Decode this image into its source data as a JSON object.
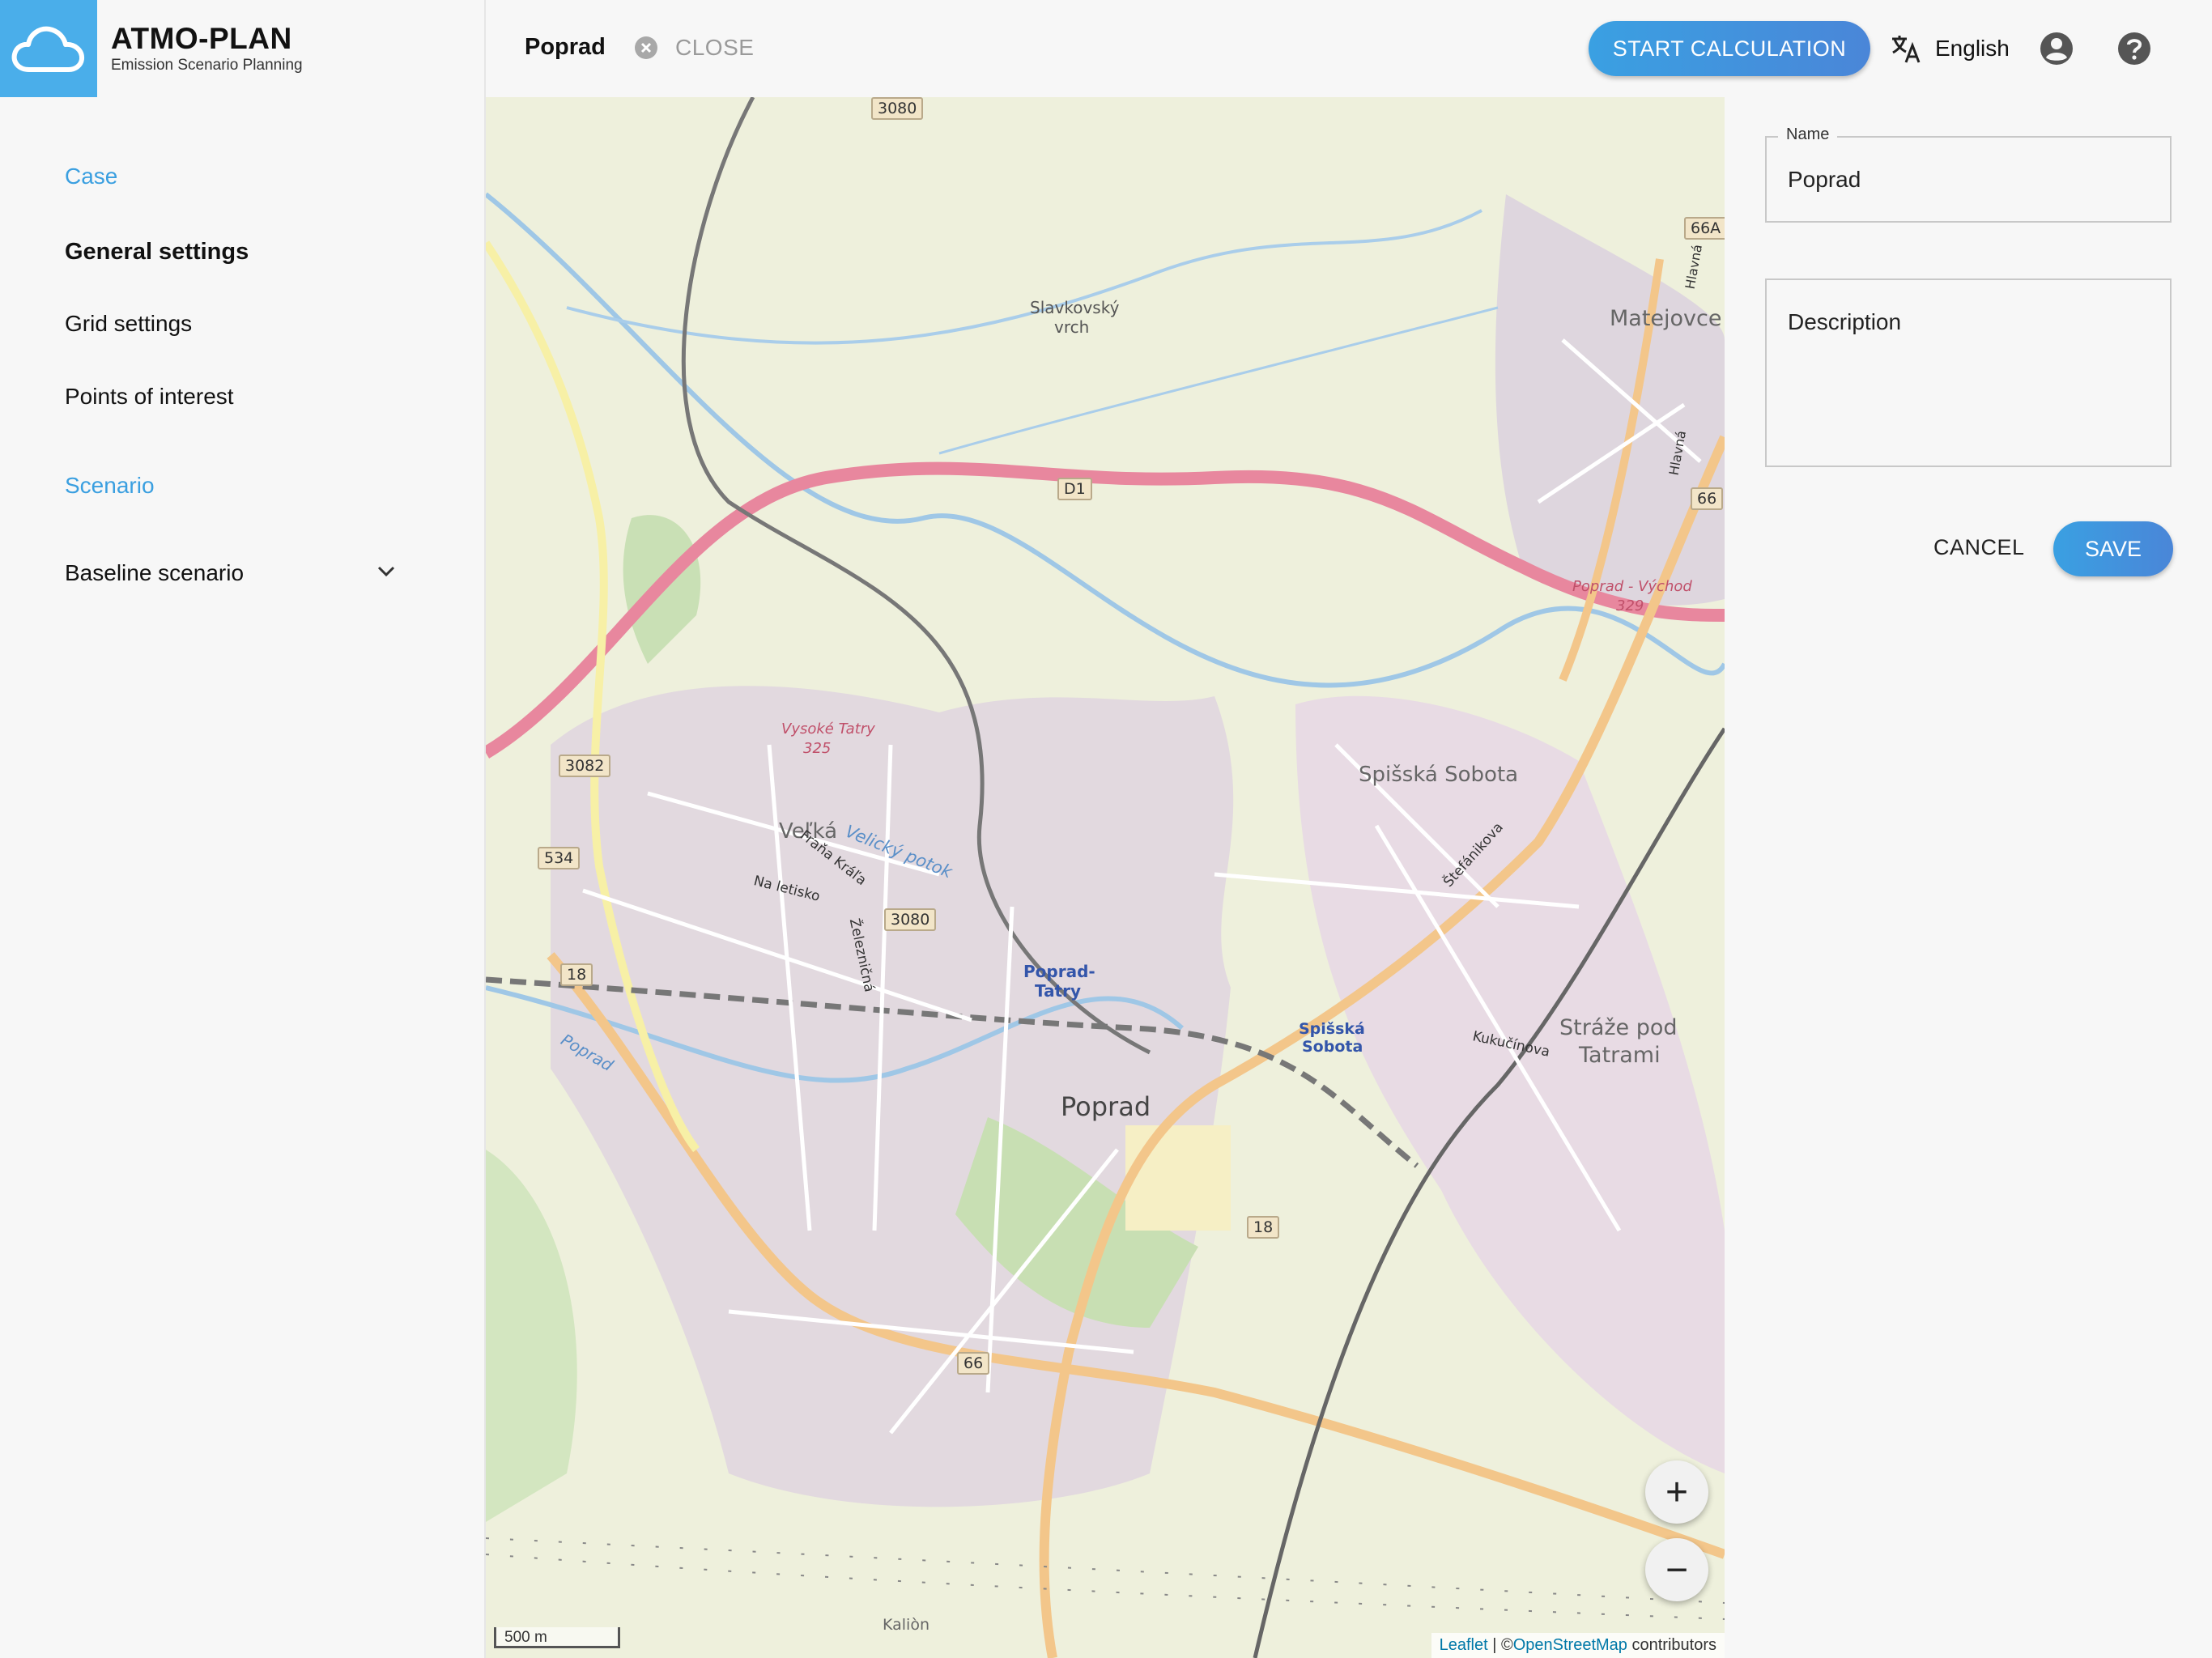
{
  "app": {
    "title": "ATMO-PLAN",
    "subtitle": "Emission Scenario Planning",
    "logo_icon": "cloud-icon"
  },
  "sidebar": {
    "case_label": "Case",
    "items": [
      {
        "label": "General settings",
        "active": true
      },
      {
        "label": "Grid settings",
        "active": false
      },
      {
        "label": "Points of interest",
        "active": false
      }
    ],
    "scenario_label": "Scenario",
    "scenario_select": "Baseline scenario"
  },
  "header": {
    "case_name": "Poprad",
    "close_label": "CLOSE",
    "start_button": "START CALCULATION",
    "language": "English",
    "icons": [
      "translate-icon",
      "account-circle-icon",
      "help-icon"
    ]
  },
  "map": {
    "labels": {
      "slavkovsky": "Slavkovský",
      "vrch": "vrch",
      "matejovce": "Matejovce",
      "velka": "Veľká",
      "velicky_potok": "Velický potok",
      "frana_krala": "Fraňa Kráľa",
      "na_letisko": "Na letisko",
      "zeleznicna": "Železničná",
      "spisska_sobota": "Spišská Sobota",
      "spisska_sobota_station_1": "Spišská",
      "spisska_sobota_station_2": "Sobota",
      "stefanikova": "Štefánikova",
      "poprad_tatry_1": "Poprad-",
      "poprad_tatry_2": "Tatry",
      "poprad": "Poprad",
      "straze_1": "Stráže pod",
      "straze_2": "Tatrami",
      "kukucinova": "Kukučínova",
      "poprad_river": "Poprad",
      "vysoke_tatry": "Vysoké Tatry",
      "exit_325": "325",
      "poprad_vychod": "Poprad - Východ",
      "exit_329": "329",
      "hlavna_1": "Hlavná",
      "hlavna_2": "Hlavná",
      "kalion": "Kaliòn"
    },
    "shields": {
      "r3080_top": "3080",
      "d1": "D1",
      "r66a": "66A",
      "r66_top": "66",
      "r3082": "3082",
      "r534": "534",
      "r3080_mid": "3080",
      "r18_left": "18",
      "r18_bottom": "18",
      "r66_bottom": "66"
    },
    "zoom_in": "+",
    "zoom_out": "−",
    "scale_label": "500 m",
    "attribution": {
      "leaflet": "Leaflet",
      "separator": " | ©",
      "osm": "OpenStreetMap",
      "suffix": " contributors"
    }
  },
  "form": {
    "name_label": "Name",
    "name_value": "Poprad",
    "description_placeholder": "Description",
    "cancel": "CANCEL",
    "save": "SAVE"
  },
  "colors": {
    "accent": "#3aa0e2",
    "logo_bg": "#4aaeea",
    "motorway": "#e8879e",
    "primary_road": "#f5c98a"
  }
}
